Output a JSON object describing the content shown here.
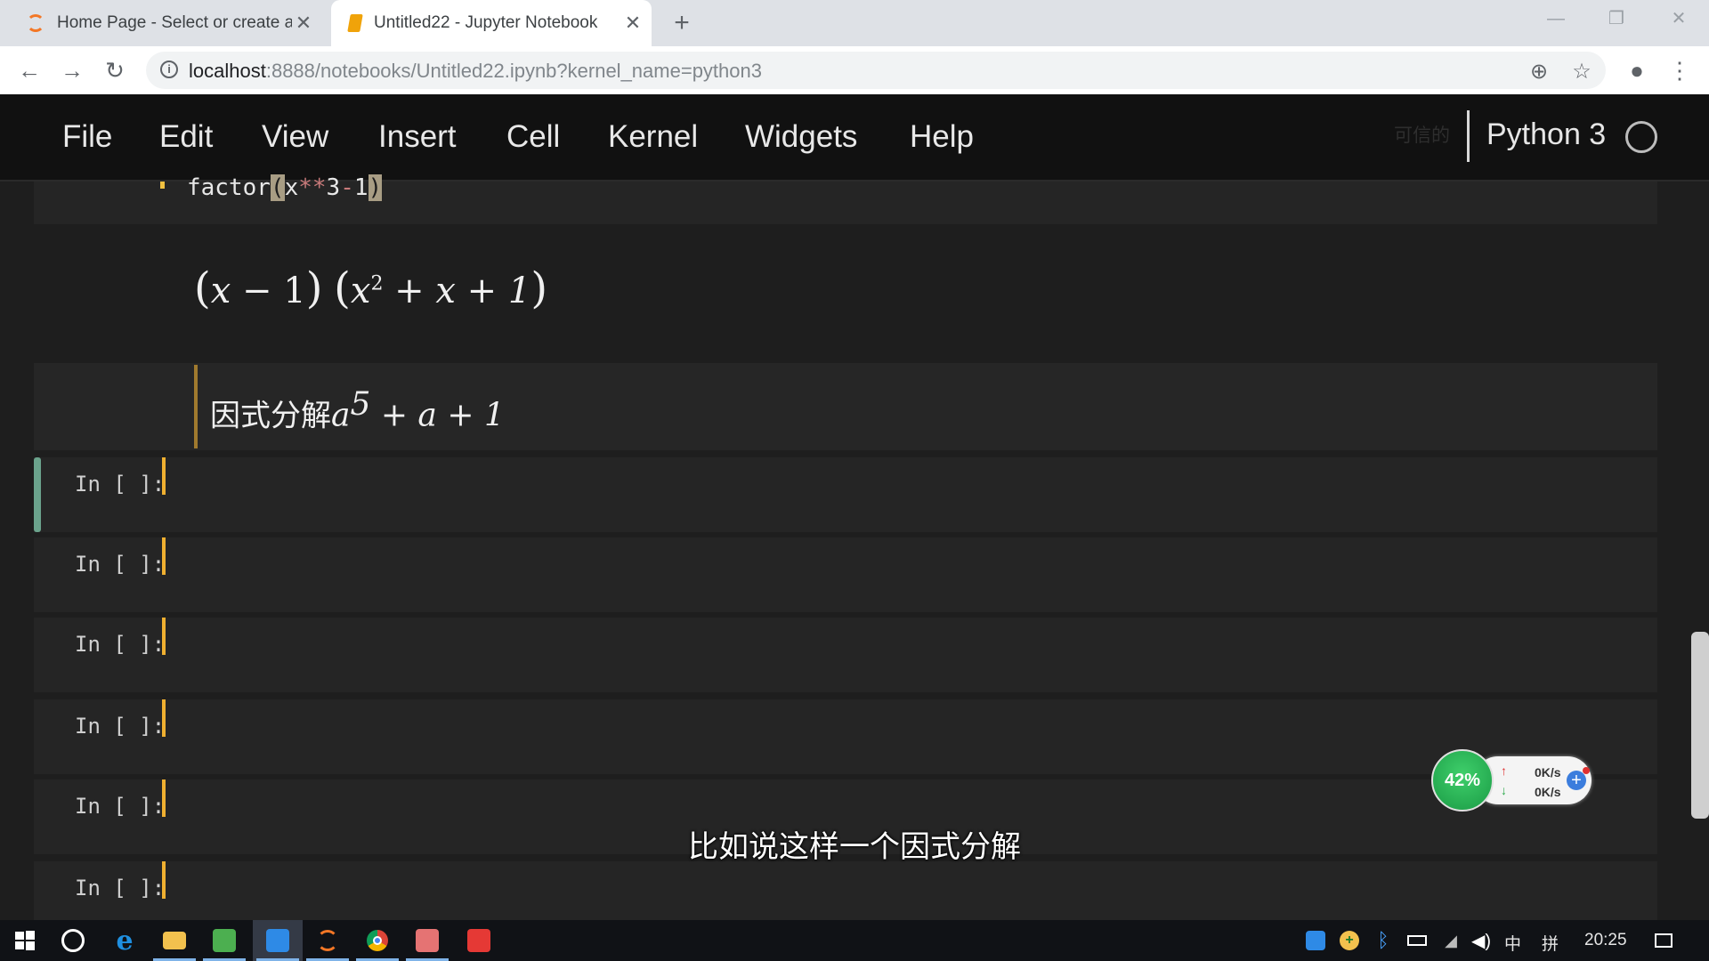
{
  "browser": {
    "tabs": [
      {
        "title": "Home Page - Select or create a",
        "active": false,
        "icon": "jupyter-spinner-icon"
      },
      {
        "title": "Untitled22 - Jupyter Notebook",
        "active": true,
        "icon": "notebook-icon"
      }
    ],
    "new_tab_symbol": "+",
    "url_host": "localhost",
    "url_rest": ":8888/notebooks/Untitled22.ipynb?kernel_name=python3"
  },
  "menu": {
    "items": [
      "File",
      "Edit",
      "View",
      "Insert",
      "Cell",
      "Kernel",
      "Widgets",
      "Help"
    ],
    "trusted_label": "可信的",
    "kernel_name": "Python 3"
  },
  "notebook": {
    "code_fragment": {
      "fn": "factor",
      "open": "(",
      "arg1": "x",
      "op1": "**",
      "arg2": "3",
      "op2": "-",
      "arg3": "1",
      "close": ")"
    },
    "output": {
      "p1": "(",
      "a": "x",
      "m": " − 1",
      "p2": ")",
      "p3": "(",
      "b": "x",
      "sup": "2",
      "rest": " + x + 1",
      "p4": ")"
    },
    "markdown": {
      "text": "因式分解",
      "base": "a",
      "sup": "5",
      "rest": " + a + 1"
    },
    "prompt": "In [ ]:",
    "empty_cell_count": 6
  },
  "subtitle": "比如说这样一个因式分解",
  "speed_widget": {
    "percent": "42%",
    "upload": "0K/s",
    "download": "0K/s"
  },
  "taskbar": {
    "clock": "20:25",
    "ime": "中",
    "ime2": "拼",
    "colors": {
      "edge": "#1f8fe0",
      "explorer": "#f2c14e",
      "notepad": "#4caf50",
      "jupyter": "#f37726",
      "chrome": "#db4437",
      "red_app": "#e53935"
    }
  }
}
